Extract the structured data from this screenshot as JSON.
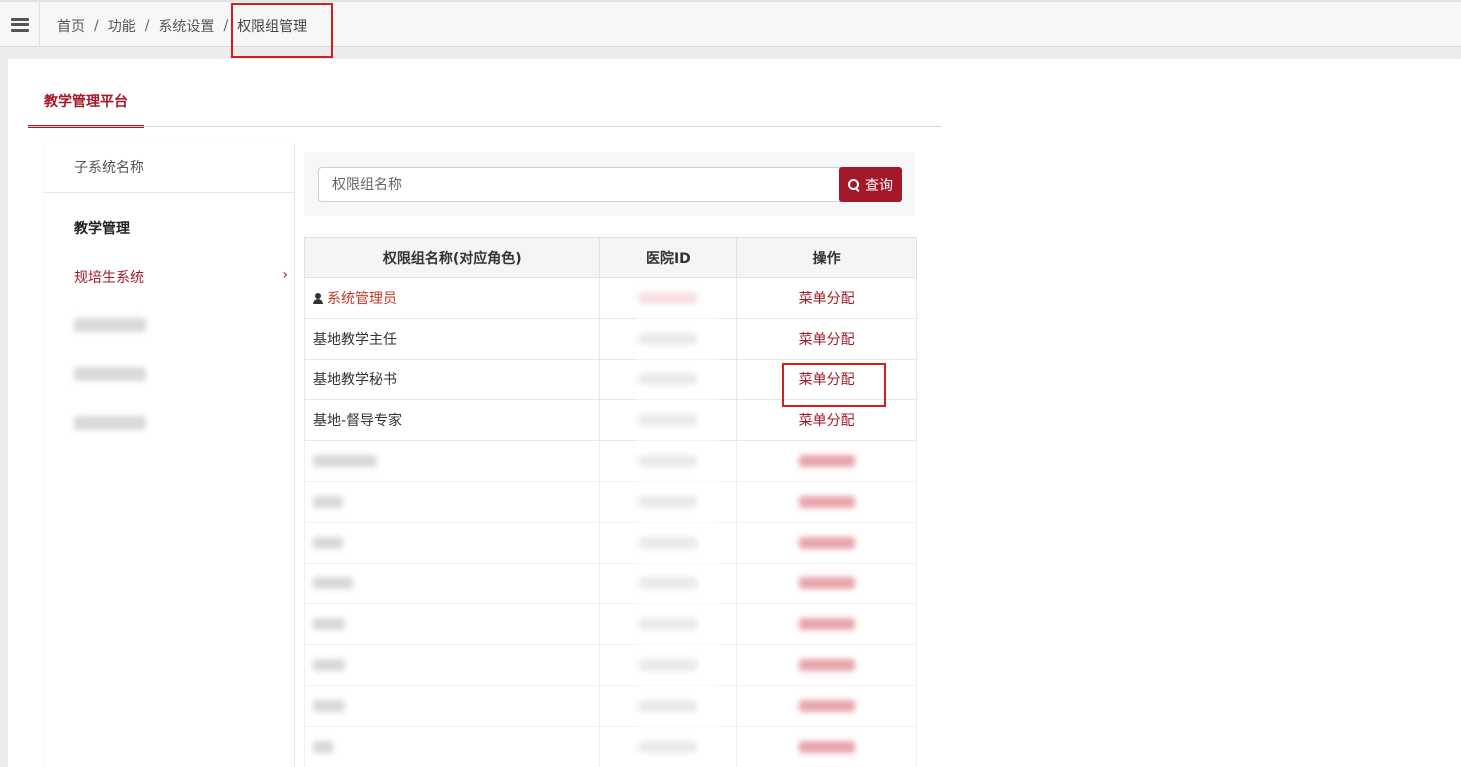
{
  "breadcrumb": {
    "items": [
      "首页",
      "功能",
      "系统设置"
    ],
    "separator": "/",
    "current": "权限组管理"
  },
  "main_tab": "教学管理平台",
  "sidebar": {
    "header": "子系统名称",
    "items": [
      {
        "label": "教学管理",
        "state": "active"
      },
      {
        "label": "规培生系统",
        "state": "highlighted",
        "arrow": "›"
      }
    ]
  },
  "search": {
    "placeholder": "权限组名称",
    "value": "",
    "button_label": "查询",
    "button_icon": "search-icon"
  },
  "table": {
    "headers": [
      "权限组名称(对应角色)",
      "医院ID",
      "操作"
    ],
    "rows": [
      {
        "name": "系统管理员",
        "icon": "user-icon",
        "action": "菜单分配"
      },
      {
        "name": "基地教学主任",
        "action": "菜单分配"
      },
      {
        "name": "基地教学秘书",
        "action": "菜单分配"
      },
      {
        "name": "基地-督导专家",
        "action": "菜单分配"
      }
    ]
  },
  "colors": {
    "accent": "#a5182a",
    "highlight_box": "#d61e1e"
  }
}
